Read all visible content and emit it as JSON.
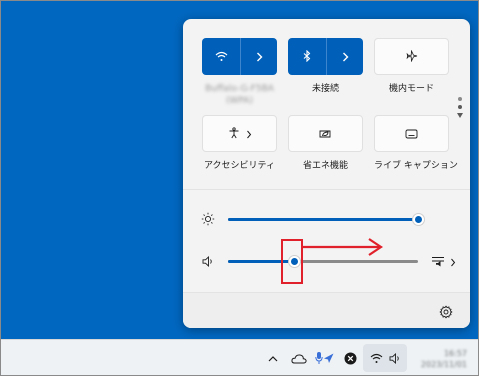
{
  "quick_settings": {
    "tiles": [
      {
        "id": "wifi",
        "label": "Buffalo-G-F5BA",
        "sublabel": "(WPA)",
        "active": true,
        "icon": "wifi-icon",
        "expand_icon": "chevron-right-icon",
        "label_blurred": true
      },
      {
        "id": "bluetooth",
        "label": "未接続",
        "active": true,
        "icon": "bluetooth-icon",
        "expand_icon": "chevron-right-icon"
      },
      {
        "id": "airplane",
        "label": "機内モード",
        "active": false,
        "icon": "airplane-icon"
      },
      {
        "id": "accessibility",
        "label": "アクセシビリティ",
        "active": false,
        "icon": "accessibility-icon",
        "expand_icon": "chevron-right-icon"
      },
      {
        "id": "energy_saver",
        "label": "省エネ機能",
        "active": false,
        "icon": "leaf-icon"
      },
      {
        "id": "live_captions",
        "label": "ライブ キャプション",
        "active": false,
        "icon": "captions-icon"
      }
    ],
    "pager": {
      "pages": 2,
      "current": 1
    },
    "brightness": {
      "icon": "brightness-icon",
      "value": 1.0
    },
    "volume": {
      "icon": "speaker-icon",
      "value": 0.35,
      "output_icon": "audio-output-icon"
    },
    "footer": {
      "settings_icon": "gear-icon"
    }
  },
  "annotation": {
    "highlight_color": "#e0202a",
    "arrow_direction": "right"
  },
  "taskbar": {
    "tray_icons": [
      "chevron-up-icon",
      "onedrive-icon",
      "microphone-location-icon",
      "close-circle-icon",
      "wifi-icon",
      "speaker-icon"
    ],
    "clock_time": "16:57",
    "clock_date": "2023/11/01"
  },
  "colors": {
    "desktop": "#0067c0",
    "accent": "#005fb8",
    "panel": "#f3f3f3",
    "annotation": "#e0202a"
  }
}
